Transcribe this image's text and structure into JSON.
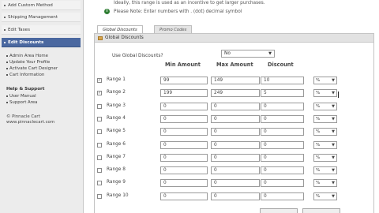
{
  "sidebar": {
    "nav_items": [
      {
        "label": "Add Custom Method",
        "active": false
      },
      {
        "label": "Shipping Management",
        "active": false
      },
      {
        "label": "Edit Taxes",
        "active": false
      },
      {
        "label": "Edit Discounts",
        "active": true
      }
    ],
    "admin_links": [
      "Admin Area Home",
      "Update Your Profile",
      "Activate Cart Designer",
      "Cart Information"
    ],
    "help_heading": "Help & Support",
    "help_links": [
      "User Manual",
      "Support Area"
    ],
    "footer_lines": [
      "© Pinnacle Cart",
      "www.pinnaclecart.com"
    ]
  },
  "main": {
    "note_top": "Ideally, this range is used as an incentive to get larger purchases.",
    "note_info": "Please Note: Enter numbers with . (dot) decimal symbol",
    "tabs": [
      {
        "label": "Global Discounts",
        "active": true
      },
      {
        "label": "Promo Codes",
        "active": false
      }
    ],
    "panel_title": "Global Discounts",
    "use_label": "Use Global Discounts?",
    "use_value": "No",
    "columns": {
      "min": "Min Amount",
      "max": "Max Amount",
      "discount": "Discount"
    },
    "rows": [
      {
        "label": "Range 1",
        "checked": true,
        "min": "99",
        "max": "149",
        "discount": "10",
        "unit": "%"
      },
      {
        "label": "Range 2",
        "checked": true,
        "min": "199",
        "max": "249",
        "discount": "5",
        "unit": "%"
      },
      {
        "label": "Range 3",
        "checked": false,
        "min": "0",
        "max": "0",
        "discount": "0",
        "unit": "%"
      },
      {
        "label": "Range 4",
        "checked": false,
        "min": "0",
        "max": "0",
        "discount": "0",
        "unit": "%"
      },
      {
        "label": "Range 5",
        "checked": false,
        "min": "0",
        "max": "0",
        "discount": "0",
        "unit": "%"
      },
      {
        "label": "Range 6",
        "checked": false,
        "min": "0",
        "max": "0",
        "discount": "0",
        "unit": "%"
      },
      {
        "label": "Range 7",
        "checked": false,
        "min": "0",
        "max": "0",
        "discount": "0",
        "unit": "%"
      },
      {
        "label": "Range 8",
        "checked": false,
        "min": "0",
        "max": "0",
        "discount": "0",
        "unit": "%"
      },
      {
        "label": "Range 9",
        "checked": false,
        "min": "0",
        "max": "0",
        "discount": "0",
        "unit": "%"
      },
      {
        "label": "Range 10",
        "checked": false,
        "min": "0",
        "max": "0",
        "discount": "0",
        "unit": "%"
      }
    ]
  },
  "colors": {
    "active_nav": "#4a68a0",
    "info_icon": "#2e7d32",
    "panel_header": "#e2e2e2"
  },
  "icons": {
    "info": "info-icon",
    "panel": "folder-icon",
    "checkbox_checked": "check-icon",
    "select_arrow": "chevron-down-icon"
  }
}
